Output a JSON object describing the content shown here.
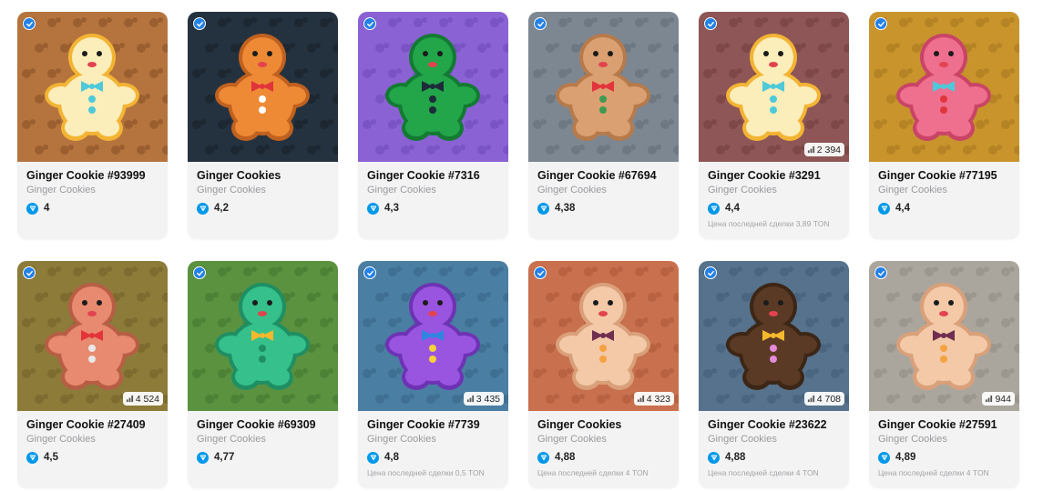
{
  "currency_icon": "ton-diamond-icon",
  "verified_icon": "verified-badge-icon",
  "stat_icon": "bar-chart-icon",
  "cards": [
    {
      "name": "Ginger Cookie #93999",
      "collection": "Ginger Cookies",
      "price": "4",
      "stat": "",
      "last_sale": "",
      "bg": "#b5743e",
      "pat": "#9b5f2f",
      "body": "#fbeebb",
      "rim": "#f3b434",
      "bow": "#4ec9d9",
      "btn": "#4ec9d9"
    },
    {
      "name": "Ginger Cookies",
      "collection": "Ginger Cookies",
      "price": "4,2",
      "stat": "",
      "last_sale": "",
      "bg": "#24323f",
      "pat": "#1c2731",
      "body": "#ee8a35",
      "rim": "#c0611f",
      "bow": "#e2343b",
      "btn": "#ffffff"
    },
    {
      "name": "Ginger Cookie #7316",
      "collection": "Ginger Cookies",
      "price": "4,3",
      "stat": "",
      "last_sale": "",
      "bg": "#8a62d4",
      "pat": "#7a53c4",
      "body": "#23a54a",
      "rim": "#137a33",
      "bow": "#1d2b3a",
      "btn": "#1d2b3a"
    },
    {
      "name": "Ginger Cookie #67694",
      "collection": "Ginger Cookies",
      "price": "4,38",
      "stat": "",
      "last_sale": "",
      "bg": "#7c8792",
      "pat": "#6d7883",
      "body": "#dba071",
      "rim": "#b77a4a",
      "bow": "#e2343b",
      "btn": "#3f9a52"
    },
    {
      "name": "Ginger Cookie #3291",
      "collection": "Ginger Cookies",
      "price": "4,4",
      "stat": "2 394",
      "last_sale": "Цена последней сделки 3,89 TON",
      "bg": "#8e5656",
      "pat": "#7e4848",
      "body": "#fbeebb",
      "rim": "#f3b434",
      "bow": "#4ec9d9",
      "btn": "#4ec9d9"
    },
    {
      "name": "Ginger Cookie #77195",
      "collection": "Ginger Cookies",
      "price": "4,4",
      "stat": "",
      "last_sale": "",
      "bg": "#c8942b",
      "pat": "#b58324",
      "body": "#ef6f8f",
      "rim": "#c94467",
      "bow": "#4ec9d9",
      "btn": "#e2343b"
    },
    {
      "name": "Ginger Cookie #27409",
      "collection": "Ginger Cookies",
      "price": "4,5",
      "stat": "4 524",
      "last_sale": "",
      "bg": "#8d7b3a",
      "pat": "#7d6b2f",
      "body": "#e78a6f",
      "rim": "#b75e45",
      "bow": "#e2343b",
      "btn": "#e8e8e8"
    },
    {
      "name": "Ginger Cookie #69309",
      "collection": "Ginger Cookies",
      "price": "4,77",
      "stat": "",
      "last_sale": "",
      "bg": "#5a9240",
      "pat": "#4c8235",
      "body": "#35c08c",
      "rim": "#1f8f63",
      "bow": "#f5b82d",
      "btn": "#1f8f63"
    },
    {
      "name": "Ginger Cookie #7739",
      "collection": "Ginger Cookies",
      "price": "4,8",
      "stat": "3 435",
      "last_sale": "Цена последней сделки 0,5 TON",
      "bg": "#4a7ea3",
      "pat": "#3f7093",
      "body": "#9a55e0",
      "rim": "#6e33b4",
      "bow": "#2e86e0",
      "btn": "#f5d23a"
    },
    {
      "name": "Ginger Cookies",
      "collection": "Ginger Cookies",
      "price": "4,88",
      "stat": "4 323",
      "last_sale": "Цена последней сделки 4 TON",
      "bg": "#c9704e",
      "pat": "#b86242",
      "body": "#f3c9a8",
      "rim": "#d9a07a",
      "bow": "#6e2f50",
      "btn": "#f5a340"
    },
    {
      "name": "Ginger Cookie #23622",
      "collection": "Ginger Cookies",
      "price": "4,88",
      "stat": "4 708",
      "last_sale": "Цена последней сделки 4 TON",
      "bg": "#56728d",
      "pat": "#4a657f",
      "body": "#5a3a24",
      "rim": "#3c2616",
      "bow": "#f5b82d",
      "btn": "#e58ad8"
    },
    {
      "name": "Ginger Cookie #27591",
      "collection": "Ginger Cookies",
      "price": "4,89",
      "stat": "944",
      "last_sale": "Цена последней сделки 4 TON",
      "bg": "#aba69d",
      "pat": "#9c978e",
      "body": "#f3c9a8",
      "rim": "#d9a07a",
      "bow": "#6e2f50",
      "btn": "#f5a340"
    }
  ]
}
